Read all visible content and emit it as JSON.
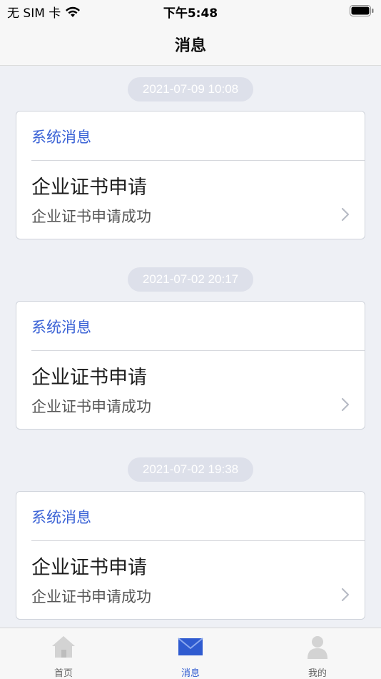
{
  "status_bar": {
    "carrier": "无 SIM 卡",
    "time": "下午5:48"
  },
  "nav": {
    "title": "消息"
  },
  "messages": [
    {
      "time": "2021-07-09 10:08",
      "category": "系统消息",
      "title": "企业证书申请",
      "desc": "企业证书申请成功"
    },
    {
      "time": "2021-07-02 20:17",
      "category": "系统消息",
      "title": "企业证书申请",
      "desc": "企业证书申请成功"
    },
    {
      "time": "2021-07-02 19:38",
      "category": "系统消息",
      "title": "企业证书申请",
      "desc": "企业证书申请成功"
    }
  ],
  "tabs": [
    {
      "label": "首页",
      "icon": "home-icon",
      "active": false
    },
    {
      "label": "消息",
      "icon": "mail-icon",
      "active": true
    },
    {
      "label": "我的",
      "icon": "user-icon",
      "active": false
    }
  ],
  "colors": {
    "accent": "#2f5bd0",
    "category": "#3a62d6",
    "background": "#eef0f5",
    "time_pill": "#dde0ea"
  }
}
